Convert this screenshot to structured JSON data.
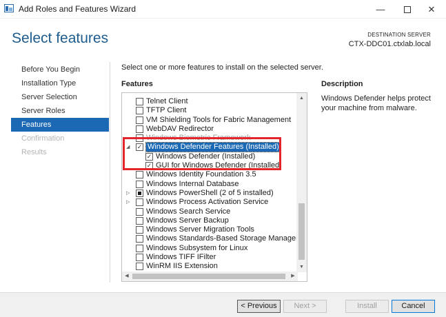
{
  "window": {
    "title": "Add Roles and Features Wizard",
    "minimize_icon": "minimize-icon",
    "maximize_icon": "maximize-icon",
    "close_icon": "close-icon"
  },
  "header": {
    "title": "Select features",
    "destination_label": "DESTINATION SERVER",
    "destination_value": "CTX-DDC01.ctxlab.local"
  },
  "nav": {
    "items": [
      {
        "label": "Before You Begin",
        "state": "normal"
      },
      {
        "label": "Installation Type",
        "state": "normal"
      },
      {
        "label": "Server Selection",
        "state": "normal"
      },
      {
        "label": "Server Roles",
        "state": "normal"
      },
      {
        "label": "Features",
        "state": "active"
      },
      {
        "label": "Confirmation",
        "state": "disabled"
      },
      {
        "label": "Results",
        "state": "disabled"
      }
    ]
  },
  "main": {
    "instruction": "Select one or more features to install on the selected server.",
    "features_heading": "Features",
    "description_heading": "Description",
    "description_text": "Windows Defender helps protect your machine from malware."
  },
  "features": [
    {
      "label": "Telnet Client",
      "level": 0,
      "checked": false
    },
    {
      "label": "TFTP Client",
      "level": 0,
      "checked": false
    },
    {
      "label": "VM Shielding Tools for Fabric Management",
      "level": 0,
      "checked": false
    },
    {
      "label": "WebDAV Redirector",
      "level": 0,
      "checked": false
    },
    {
      "label": "Windows Biometric Framework",
      "level": 0,
      "checked": false,
      "faded": true
    },
    {
      "label": "Windows Defender Features (Installed)",
      "level": 0,
      "checked": true,
      "expanded": true,
      "selected": true
    },
    {
      "label": "Windows Defender (Installed)",
      "level": 1,
      "checked": true
    },
    {
      "label": "GUI for Windows Defender (Installed)",
      "level": 1,
      "checked": true
    },
    {
      "label": "Windows Identity Foundation 3.5",
      "level": 0,
      "checked": false
    },
    {
      "label": "Windows Internal Database",
      "level": 0,
      "checked": false
    },
    {
      "label": "Windows PowerShell (2 of 5 installed)",
      "level": 0,
      "checked": "partial",
      "collapsed": true
    },
    {
      "label": "Windows Process Activation Service",
      "level": 0,
      "checked": false,
      "collapsed": true
    },
    {
      "label": "Windows Search Service",
      "level": 0,
      "checked": false
    },
    {
      "label": "Windows Server Backup",
      "level": 0,
      "checked": false
    },
    {
      "label": "Windows Server Migration Tools",
      "level": 0,
      "checked": false
    },
    {
      "label": "Windows Standards-Based Storage Management",
      "level": 0,
      "checked": false
    },
    {
      "label": "Windows Subsystem for Linux",
      "level": 0,
      "checked": false
    },
    {
      "label": "Windows TIFF IFilter",
      "level": 0,
      "checked": false
    },
    {
      "label": "WinRM IIS Extension",
      "level": 0,
      "checked": false
    }
  ],
  "footer": {
    "previous": "< Previous",
    "next": "Next >",
    "install": "Install",
    "cancel": "Cancel"
  },
  "colors": {
    "accent": "#1b68b4",
    "title": "#1e5c8e",
    "highlight_box": "#e3242b"
  }
}
